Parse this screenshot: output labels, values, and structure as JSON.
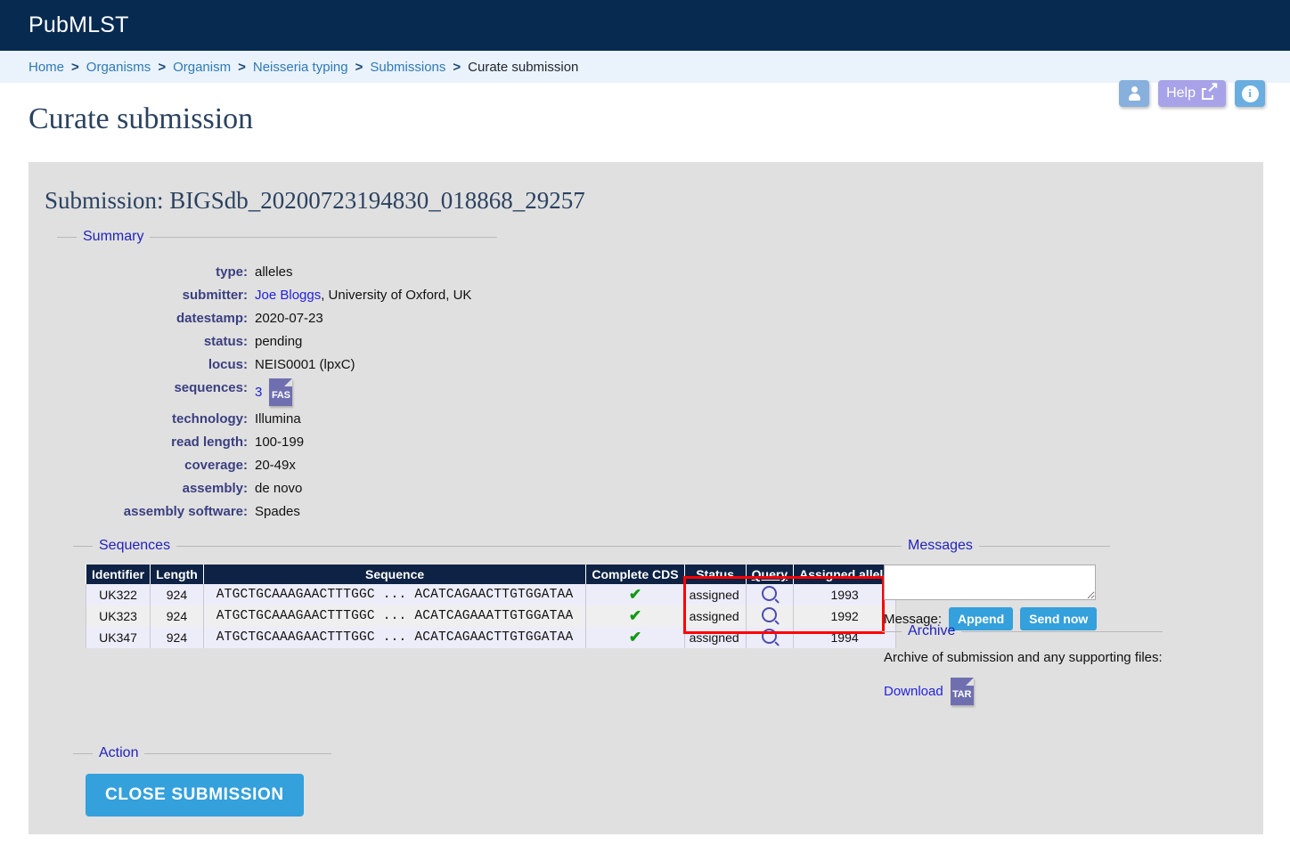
{
  "header": {
    "site_title": "PubMLST"
  },
  "breadcrumb": {
    "items": [
      {
        "label": "Home",
        "current": false
      },
      {
        "label": "Organisms",
        "current": false
      },
      {
        "label": "Organism",
        "current": false
      },
      {
        "label": "Neisseria typing",
        "current": false
      },
      {
        "label": "Submissions",
        "current": false
      },
      {
        "label": "Curate submission",
        "current": true
      }
    ],
    "separator": ">"
  },
  "topbar": {
    "user_icon": "user-icon",
    "help_label": "Help",
    "help_icon": "external-link-icon",
    "info_icon": "info-icon"
  },
  "page": {
    "title": "Curate submission",
    "submission_heading": "Submission: BIGSdb_20200723194830_018868_29257"
  },
  "summary": {
    "legend": "Summary",
    "rows": [
      {
        "label": "type:",
        "value": "alleles"
      },
      {
        "label": "submitter:",
        "link": "Joe Bloggs",
        "value": ", University of Oxford, UK"
      },
      {
        "label": "datestamp:",
        "value": "2020-07-23"
      },
      {
        "label": "status:",
        "value": "pending"
      },
      {
        "label": "locus:",
        "value": "NEIS0001 (lpxC)"
      },
      {
        "label": "sequences:",
        "value": "3",
        "file_icon": "FAS"
      },
      {
        "label": "technology:",
        "value": "Illumina"
      },
      {
        "label": "read length:",
        "value": "100-199"
      },
      {
        "label": "coverage:",
        "value": "20-49x"
      },
      {
        "label": "assembly:",
        "value": "de novo"
      },
      {
        "label": "assembly software:",
        "value": "Spades"
      }
    ]
  },
  "sequences": {
    "legend": "Sequences",
    "columns": [
      "Identifier",
      "Length",
      "Sequence",
      "Complete CDS",
      "Status",
      "Query",
      "Assigned allele"
    ],
    "rows": [
      {
        "identifier": "UK322",
        "length": "924",
        "sequence": "ATGCTGCAAAGAACTTTGGC ... ACATCAGAACTTGTGGATAA",
        "complete_cds": "✔",
        "status": "assigned",
        "query_icon": "search-icon",
        "assigned_allele": "1993"
      },
      {
        "identifier": "UK323",
        "length": "924",
        "sequence": "ATGCTGCAAAGAACTTTGGC ... ACATCAGAAATTGTGGATAA",
        "complete_cds": "✔",
        "status": "assigned",
        "query_icon": "search-icon",
        "assigned_allele": "1992"
      },
      {
        "identifier": "UK347",
        "length": "924",
        "sequence": "ATGCTGCAAAGAACTTTGGC ... ACATCAGAACTTGTGGATAA",
        "complete_cds": "✔",
        "status": "assigned",
        "query_icon": "search-icon",
        "assigned_allele": "1994"
      }
    ],
    "highlight_color": "#ff0000"
  },
  "messages": {
    "legend": "Messages",
    "textarea_value": "",
    "textarea_placeholder": "",
    "label": "Message:",
    "append_label": "Append",
    "send_label": "Send now"
  },
  "archive": {
    "legend": "Archive",
    "description": "Archive of submission and any supporting files:",
    "download_label": "Download",
    "file_icon": "TAR"
  },
  "action": {
    "legend": "Action",
    "close_label": "CLOSE SUBMISSION"
  },
  "colors": {
    "header_bg": "#072a51",
    "breadcrumb_bg": "#eaf2fb",
    "panel_bg": "#e0e0e0",
    "accent_blue": "#34a0dc",
    "link_blue": "#2222dd",
    "table_header_bg": "#0d2244",
    "check_green": "#119911"
  }
}
